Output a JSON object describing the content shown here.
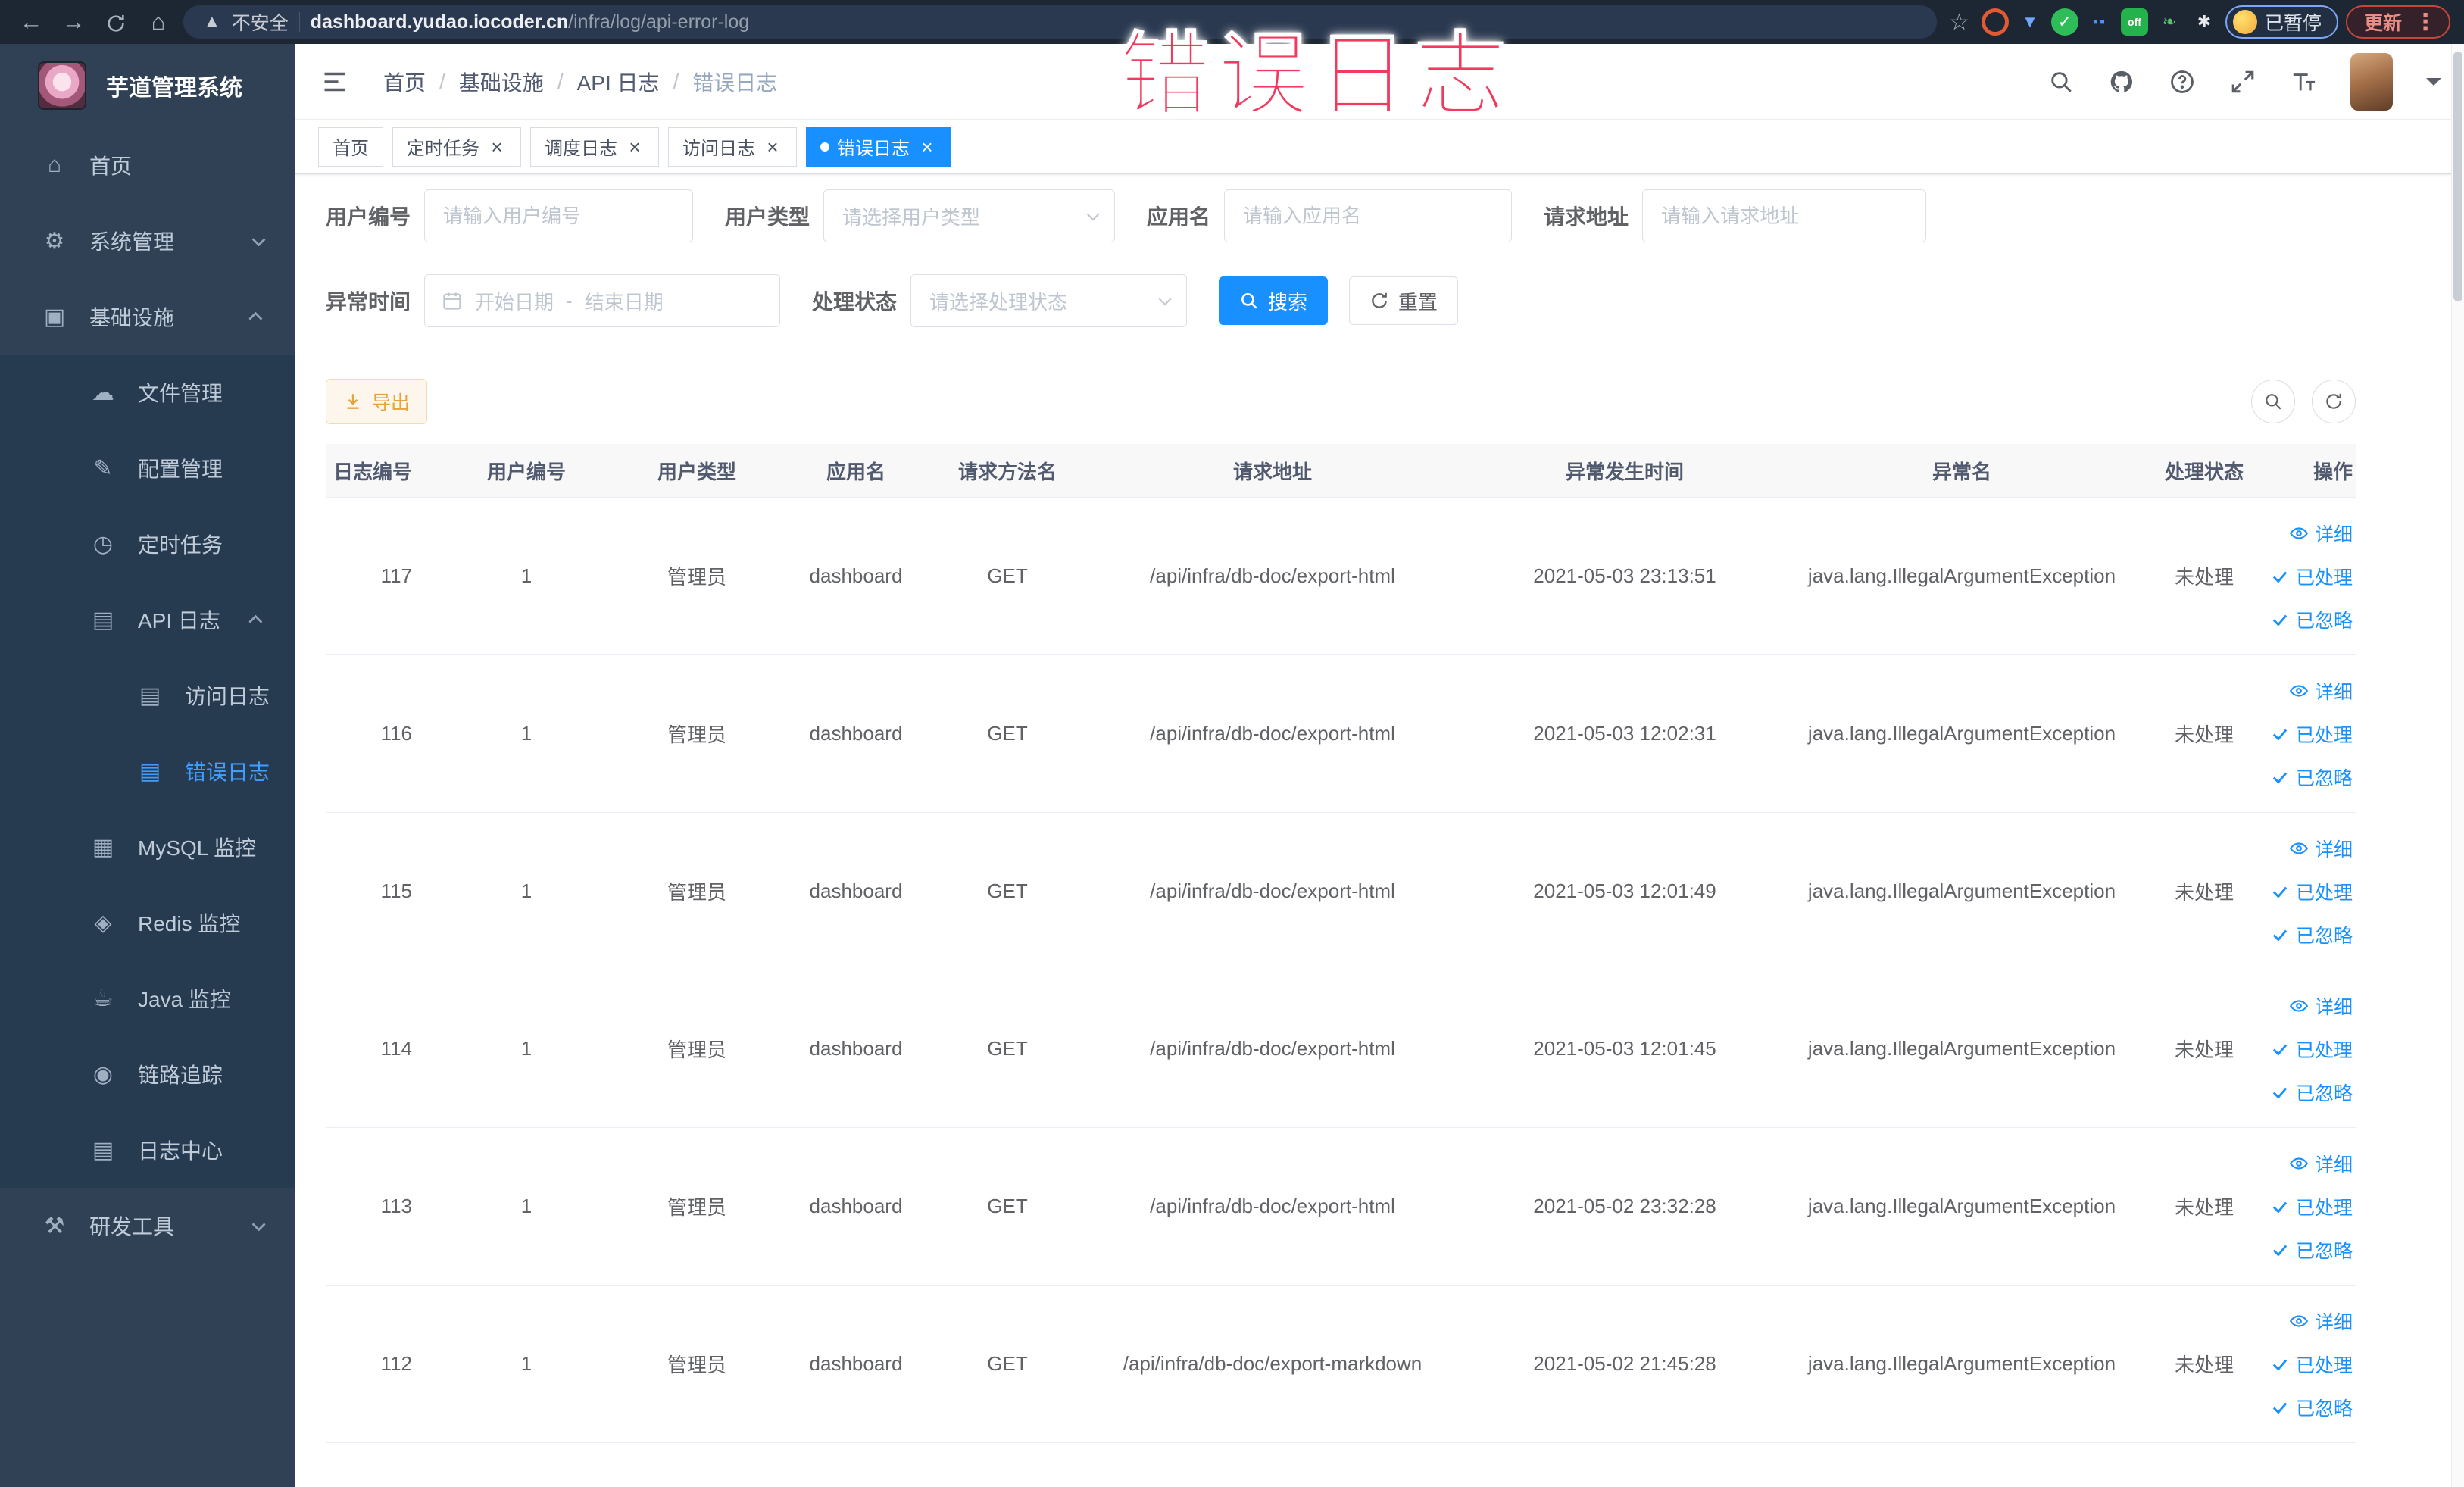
{
  "overlay": {
    "text": "错误日志"
  },
  "browser": {
    "insecure_label": "不安全",
    "url_host": "dashboard.yudao.iocoder.cn",
    "url_path": "/infra/log/api-error-log",
    "paused_label": "已暂停",
    "update_label": "更新"
  },
  "sidebar": {
    "logo_title": "芋道管理系统",
    "items": [
      {
        "id": "home",
        "label": "首页",
        "icon": "home-icon"
      },
      {
        "id": "system-management",
        "label": "系统管理",
        "icon": "gear-icon",
        "expandable": true,
        "expanded": false
      },
      {
        "id": "infrastructure",
        "label": "基础设施",
        "icon": "monitor-icon",
        "expandable": true,
        "expanded": true,
        "children": [
          {
            "id": "file-management",
            "label": "文件管理",
            "icon": "cloud-upload-icon"
          },
          {
            "id": "config-management",
            "label": "配置管理",
            "icon": "edit-icon"
          },
          {
            "id": "scheduled-tasks",
            "label": "定时任务",
            "icon": "timer-icon"
          },
          {
            "id": "api-logs",
            "label": "API 日志",
            "icon": "log-icon",
            "expandable": true,
            "expanded": true,
            "children": [
              {
                "id": "access-logs",
                "label": "访问日志",
                "icon": "log-icon"
              },
              {
                "id": "error-logs",
                "label": "错误日志",
                "icon": "log-icon",
                "active": true
              }
            ]
          },
          {
            "id": "mysql-monitor",
            "label": "MySQL 监控",
            "icon": "database-icon"
          },
          {
            "id": "redis-monitor",
            "label": "Redis 监控",
            "icon": "layers-icon"
          },
          {
            "id": "java-monitor",
            "label": "Java 监控",
            "icon": "coffee-icon"
          },
          {
            "id": "link-tracing",
            "label": "链路追踪",
            "icon": "eye-icon"
          },
          {
            "id": "log-center",
            "label": "日志中心",
            "icon": "document-icon"
          }
        ]
      },
      {
        "id": "dev-tools",
        "label": "研发工具",
        "icon": "toolbox-icon",
        "expandable": true,
        "expanded": false
      }
    ]
  },
  "header": {
    "breadcrumb": [
      "首页",
      "基础设施",
      "API 日志",
      "错误日志"
    ]
  },
  "tabs": [
    {
      "id": "home",
      "label": "首页",
      "closable": false,
      "active": false
    },
    {
      "id": "scheduled-tasks",
      "label": "定时任务",
      "closable": true,
      "active": false
    },
    {
      "id": "schedule-logs",
      "label": "调度日志",
      "closable": true,
      "active": false
    },
    {
      "id": "access-logs",
      "label": "访问日志",
      "closable": true,
      "active": false
    },
    {
      "id": "error-logs",
      "label": "错误日志",
      "closable": true,
      "active": true
    }
  ],
  "filters": {
    "user_id": {
      "label": "用户编号",
      "placeholder": "请输入用户编号"
    },
    "user_type": {
      "label": "用户类型",
      "placeholder": "请选择用户类型"
    },
    "app_name": {
      "label": "应用名",
      "placeholder": "请输入应用名"
    },
    "request_url": {
      "label": "请求地址",
      "placeholder": "请输入请求地址"
    },
    "exception_time": {
      "label": "异常时间",
      "start_placeholder": "开始日期",
      "separator": "-",
      "end_placeholder": "结束日期"
    },
    "process_status": {
      "label": "处理状态",
      "placeholder": "请选择处理状态"
    },
    "search_label": "搜索",
    "reset_label": "重置"
  },
  "toolbar": {
    "export_label": "导出"
  },
  "table": {
    "columns": [
      {
        "key": "log_id",
        "label": "日志编号"
      },
      {
        "key": "user_id",
        "label": "用户编号"
      },
      {
        "key": "user_type",
        "label": "用户类型"
      },
      {
        "key": "app_name",
        "label": "应用名"
      },
      {
        "key": "method",
        "label": "请求方法名"
      },
      {
        "key": "url",
        "label": "请求地址"
      },
      {
        "key": "time",
        "label": "异常发生时间"
      },
      {
        "key": "exception",
        "label": "异常名"
      },
      {
        "key": "status",
        "label": "处理状态"
      },
      {
        "key": "actions",
        "label": "操作"
      }
    ],
    "action_labels": {
      "detail": "详细",
      "processed": "已处理",
      "ignored": "已忽略"
    },
    "rows": [
      {
        "log_id": "117",
        "user_id": "1",
        "user_type": "管理员",
        "app_name": "dashboard",
        "method": "GET",
        "url": "/api/infra/db-doc/export-html",
        "time": "2021-05-03 23:13:51",
        "exception": "java.lang.IllegalArgumentException",
        "status": "未处理"
      },
      {
        "log_id": "116",
        "user_id": "1",
        "user_type": "管理员",
        "app_name": "dashboard",
        "method": "GET",
        "url": "/api/infra/db-doc/export-html",
        "time": "2021-05-03 12:02:31",
        "exception": "java.lang.IllegalArgumentException",
        "status": "未处理"
      },
      {
        "log_id": "115",
        "user_id": "1",
        "user_type": "管理员",
        "app_name": "dashboard",
        "method": "GET",
        "url": "/api/infra/db-doc/export-html",
        "time": "2021-05-03 12:01:49",
        "exception": "java.lang.IllegalArgumentException",
        "status": "未处理"
      },
      {
        "log_id": "114",
        "user_id": "1",
        "user_type": "管理员",
        "app_name": "dashboard",
        "method": "GET",
        "url": "/api/infra/db-doc/export-html",
        "time": "2021-05-03 12:01:45",
        "exception": "java.lang.IllegalArgumentException",
        "status": "未处理"
      },
      {
        "log_id": "113",
        "user_id": "1",
        "user_type": "管理员",
        "app_name": "dashboard",
        "method": "GET",
        "url": "/api/infra/db-doc/export-html",
        "time": "2021-05-02 23:32:28",
        "exception": "java.lang.IllegalArgumentException",
        "status": "未处理"
      },
      {
        "log_id": "112",
        "user_id": "1",
        "user_type": "管理员",
        "app_name": "dashboard",
        "method": "GET",
        "url": "/api/infra/db-doc/export-markdown",
        "time": "2021-05-02 21:45:28",
        "exception": "java.lang.IllegalArgumentException",
        "status": "未处理"
      }
    ]
  },
  "colors": {
    "primary": "#1890ff",
    "menu_active": "#409eff",
    "warning": "#e6a23c",
    "sidebar_bg": "#304156",
    "submenu_bg": "#263a50",
    "overlay_red": "#f23a5f"
  }
}
